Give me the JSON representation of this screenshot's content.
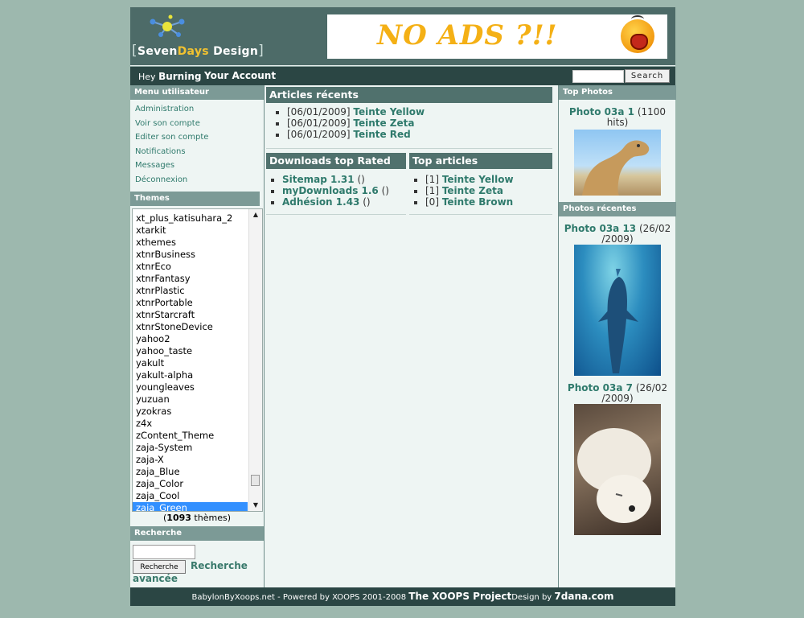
{
  "header": {
    "logo_prefix": "Seven",
    "logo_highlight": "Days",
    "logo_suffix": "Design",
    "banner_text": "NO ADS ?!!"
  },
  "navbar": {
    "greeting": "Hey",
    "username": "Burning",
    "account_link": "Your Account",
    "search_button": "Search"
  },
  "user_menu": {
    "title": "Menu utilisateur",
    "items": [
      "Administration",
      "Voir son compte",
      "Editer son compte",
      "Notifications",
      "Messages",
      "Déconnexion"
    ]
  },
  "themes": {
    "title": "Themes",
    "items": [
      "xt_plus_katisuhara_2",
      "xtarkit",
      "xthemes",
      "xtnrBusiness",
      "xtnrEco",
      "xtnrFantasy",
      "xtnrPlastic",
      "xtnrPortable",
      "xtnrStarcraft",
      "xtnrStoneDevice",
      "yahoo2",
      "yahoo_taste",
      "yakult",
      "yakult-alpha",
      "youngleaves",
      "yuzuan",
      "yzokras",
      "z4x",
      "zContent_Theme",
      "zaja-System",
      "zaja-X",
      "zaja_Blue",
      "zaja_Color",
      "zaja_Cool",
      "zaja_Green"
    ],
    "selected": "zaja_Green",
    "count_open": "(",
    "count": "1093",
    "count_suffix": "thèmes)"
  },
  "search_block": {
    "title": "Recherche",
    "button": "Recherche",
    "advanced_link": "Recherche avancée"
  },
  "articles_recents": {
    "title": "Articles récents",
    "items": [
      {
        "date": "[06/01/2009]",
        "title": "Teinte Yellow"
      },
      {
        "date": "[06/01/2009]",
        "title": "Teinte Zeta"
      },
      {
        "date": "[06/01/2009]",
        "title": "Teinte Red"
      }
    ]
  },
  "downloads_top": {
    "title": "Downloads top Rated",
    "items": [
      {
        "title": "Sitemap 1.31",
        "paren": "()"
      },
      {
        "title": "myDownloads 1.6",
        "paren": "()"
      },
      {
        "title": "Adhésion 1.43",
        "paren": "()"
      }
    ]
  },
  "top_articles": {
    "title": "Top articles",
    "items": [
      {
        "count": "[1]",
        "title": "Teinte Yellow"
      },
      {
        "count": "[1]",
        "title": "Teinte Zeta"
      },
      {
        "count": "[0]",
        "title": "Teinte Brown"
      }
    ]
  },
  "top_photos": {
    "title": "Top Photos",
    "photo": {
      "title": "Photo 03a 1",
      "meta": "(1100 hits)"
    }
  },
  "recent_photos": {
    "title": "Photos récentes",
    "photos": [
      {
        "title": "Photo 03a 13",
        "meta": "(26/02 /2009)"
      },
      {
        "title": "Photo 03a 7",
        "meta": "(26/02 /2009)"
      }
    ]
  },
  "footer": {
    "text_plain": "BabylonByXoops.net - Powered by XOOPS 2001-2008",
    "project": "The XOOPS Project",
    "design_by": "Design by",
    "designer": "7dana.com"
  }
}
